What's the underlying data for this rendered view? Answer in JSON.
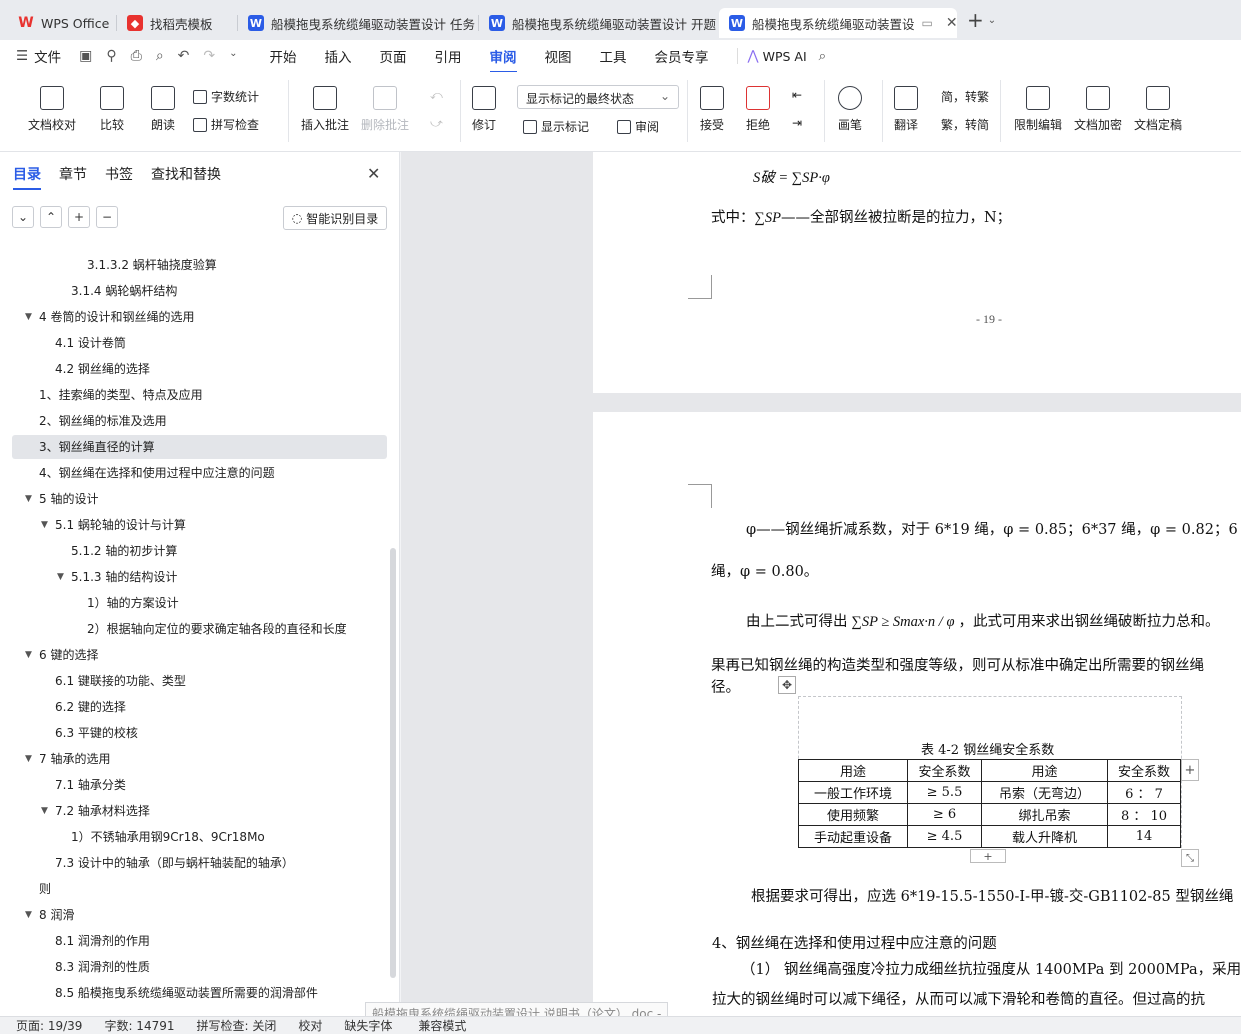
{
  "tabs": [
    {
      "label": "WPS Office",
      "icon": "wps-logo-icon",
      "color": "#e8322f"
    },
    {
      "label": "找稻壳模板",
      "icon": "docer-icon",
      "color": "#e8322f"
    },
    {
      "label": "船模拖曳系统缆绳驱动装置设计 任务",
      "icon": "word-doc-icon",
      "color": "#2b5ce6"
    },
    {
      "label": "船模拖曳系统缆绳驱动装置设计 开题",
      "icon": "word-doc-icon",
      "color": "#2b5ce6"
    },
    {
      "label": "船模拖曳系统缆绳驱动装置设",
      "icon": "word-doc-icon",
      "color": "#2b5ce6"
    }
  ],
  "menu": {
    "file": "文件",
    "items": [
      "开始",
      "插入",
      "页面",
      "引用",
      "审阅",
      "视图",
      "工具",
      "会员专享"
    ],
    "active": "审阅",
    "ai": "WPS AI"
  },
  "ribbon": {
    "doc_check": "文档校对",
    "compare": "比较",
    "read_aloud": "朗读",
    "word_count": "字数统计",
    "spell_check": "拼写检查",
    "insert_comment": "插入批注",
    "delete_comment": "删除批注",
    "revise": "修订",
    "markup_state": "显示标记的最终状态",
    "show_markup": "显示标记",
    "review": "审阅",
    "accept": "接受",
    "reject": "拒绝",
    "pen": "画笔",
    "translate": "翻译",
    "simp_to_trad": "简，转繁",
    "trad_to_simp": "繁，转简",
    "restrict_edit": "限制编辑",
    "encrypt": "文档加密",
    "finalize": "文档定稿"
  },
  "sidebar": {
    "tabs": [
      "目录",
      "章节",
      "书签",
      "查找和替换"
    ],
    "active_tab": "目录",
    "smart_toc": "智能识别目录",
    "toc": [
      {
        "text": "3.1.3.2 蜗杆轴挠度验算",
        "level": 4,
        "arrow": ""
      },
      {
        "text": "3.1.4 蜗轮蜗杆结构",
        "level": 3,
        "arrow": ""
      },
      {
        "text": "4 卷筒的设计和钢丝绳的选用",
        "level": 1,
        "arrow": "▼"
      },
      {
        "text": "4.1 设计卷筒",
        "level": 2,
        "arrow": ""
      },
      {
        "text": "4.2 钢丝绳的选择",
        "level": 2,
        "arrow": ""
      },
      {
        "text": "1、挂索绳的类型、特点及应用",
        "level": 1,
        "arrow": ""
      },
      {
        "text": "2、钢丝绳的标准及选用",
        "level": 1,
        "arrow": ""
      },
      {
        "text": "3、钢丝绳直径的计算",
        "level": 1,
        "arrow": "",
        "selected": true
      },
      {
        "text": "4、钢丝绳在选择和使用过程中应注意的问题",
        "level": 1,
        "arrow": ""
      },
      {
        "text": "5 轴的设计",
        "level": 1,
        "arrow": "▼"
      },
      {
        "text": "5.1 蜗轮轴的设计与计算",
        "level": 2,
        "arrow": "▼"
      },
      {
        "text": "5.1.2 轴的初步计算",
        "level": 3,
        "arrow": ""
      },
      {
        "text": "5.1.3 轴的结构设计",
        "level": 3,
        "arrow": "▼"
      },
      {
        "text": "1）轴的方案设计",
        "level": 4,
        "arrow": ""
      },
      {
        "text": "2）根据轴向定位的要求确定轴各段的直径和长度",
        "level": 4,
        "arrow": ""
      },
      {
        "text": "6 键的选择",
        "level": 1,
        "arrow": "▼"
      },
      {
        "text": "6.1 键联接的功能、类型",
        "level": 2,
        "arrow": ""
      },
      {
        "text": "6.2 键的选择",
        "level": 2,
        "arrow": ""
      },
      {
        "text": "6.3 平键的校核",
        "level": 2,
        "arrow": ""
      },
      {
        "text": "7 轴承的选用",
        "level": 1,
        "arrow": "▼"
      },
      {
        "text": "7.1 轴承分类",
        "level": 2,
        "arrow": ""
      },
      {
        "text": "7.2 轴承材料选择",
        "level": 2,
        "arrow": "▼"
      },
      {
        "text": "1）不锈轴承用钢9Cr18、9Cr18Mo",
        "level": 3,
        "arrow": ""
      },
      {
        "text": "7.3 设计中的轴承（即与蜗杆轴装配的轴承）",
        "level": 2,
        "arrow": ""
      },
      {
        "text": "则",
        "level": 1,
        "arrow": ""
      },
      {
        "text": "8 润滑",
        "level": 1,
        "arrow": "▼"
      },
      {
        "text": "8.1 润滑剂的作用",
        "level": 2,
        "arrow": ""
      },
      {
        "text": "8.3 润滑剂的性质",
        "level": 2,
        "arrow": ""
      },
      {
        "text": "8.5 船模拖曳系统缆绳驱动装置所需要的润滑部件",
        "level": 2,
        "arrow": ""
      }
    ]
  },
  "doc": {
    "formula_top": "S破 = ∑SP·φ",
    "formula_note_prefix": "式中：",
    "formula_note_sum": "∑SP",
    "formula_note_text": "——全部钢丝被拉断是的拉力，N；",
    "page_number": "- 19 -",
    "phi_line": "φ——钢丝绳折减系数，对于 6*19 绳，φ = 0.85；6*37 绳，φ = 0.82；6",
    "phi_line2": "绳，φ = 0.80。",
    "derive_prefix": "由上二式可得出",
    "derive_formula": "∑SP ≥ Smax·n / φ",
    "derive_suffix": "，此式可用来求出钢丝绳破断拉力总和。",
    "para2_line1": "果再已知钢丝绳的构造类型和强度等级，则可从标准中确定出所需要的钢丝绳",
    "para2_line2": "径。",
    "table_caption": "表 4-2 钢丝绳安全系数",
    "table_header": [
      "用途",
      "安全系数",
      "用途",
      "安全系数"
    ],
    "table_rows": [
      [
        "一般工作环境",
        "≥ 5.5",
        "吊索（无弯边）",
        "6 ： 7"
      ],
      [
        "使用频繁",
        "≥ 6",
        "绑扎吊索",
        "8 ： 10"
      ],
      [
        "手动起重设备",
        "≥ 4.5",
        "载人升降机",
        "14"
      ]
    ],
    "select_line": "根据要求可得出，应选 6*19-15.5-1550-I-甲-镀-交-GB1102-85 型钢丝绳",
    "heading4": "4、钢丝绳在选择和使用过程中应注意的问题",
    "item1_line1": "（1） 钢丝绳高强度冷拉力成细丝抗拉强度从 1400MPa 到 2000MPa，采用",
    "item1_line2": "拉大的钢丝绳时可以减下绳径，从而可以减下滑轮和卷筒的直径。但过高的抗"
  },
  "status": {
    "page": "页面: 19/39",
    "words": "字数: 14791",
    "spell": "拼写检查: 关闭",
    "proof": "校对",
    "missing_font": "缺失字体",
    "compat": "兼容模式",
    "tooltip": "船模拖曳系统缆绳驱动装置设计  说明书（论文）.doc -"
  }
}
